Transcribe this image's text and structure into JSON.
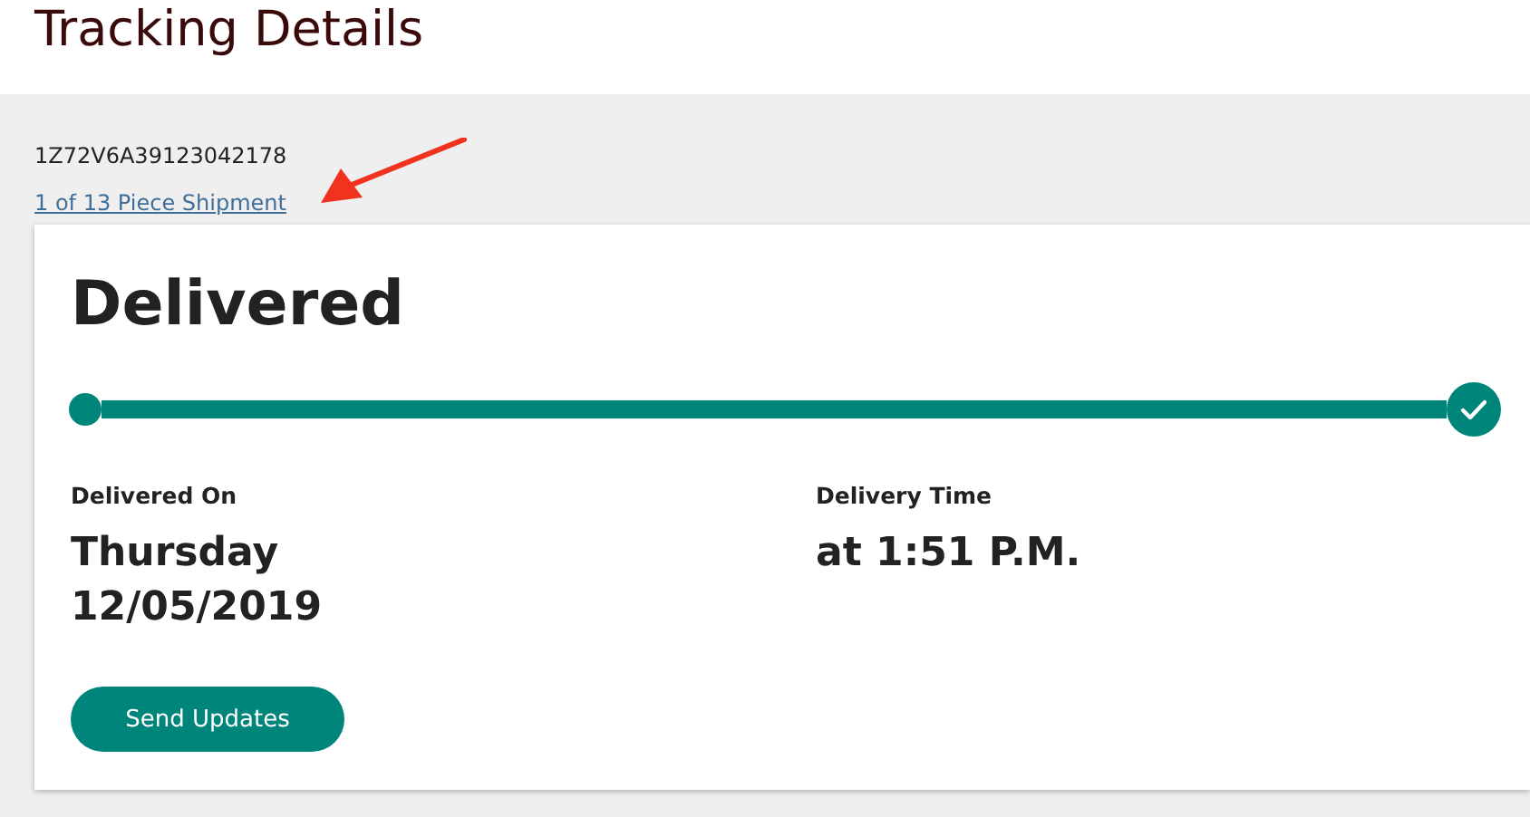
{
  "page_title": "Tracking Details",
  "tracking_number": "1Z72V6A39123042178",
  "shipment_link": "1 of 13 Piece Shipment",
  "annotation": {
    "kind": "arrow"
  },
  "status": "Delivered",
  "progress": {
    "complete": true
  },
  "details": [
    {
      "label": "Delivered On",
      "value_lines": [
        "Thursday",
        "12/05/2019"
      ]
    },
    {
      "label": "Delivery Time",
      "value_lines": [
        "at 1:51 P.M."
      ]
    }
  ],
  "button": "Send Updates"
}
